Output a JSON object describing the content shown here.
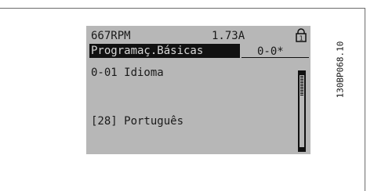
{
  "status": {
    "speed": "667RPM",
    "current": "1.73A",
    "lock_icon": "lock-1-icon"
  },
  "menu": {
    "title": "Programaç.Básicas",
    "group": "0-0*"
  },
  "parameter": {
    "name": "0-01 Idioma",
    "value": "[28] Português"
  },
  "scrollbar": {
    "position": 0.1
  },
  "figure_code": "130BP068.10",
  "colors": {
    "lcd_background": "#b7b7b7",
    "lcd_text": "#1a1a1a",
    "highlight_bar": "#111111"
  }
}
